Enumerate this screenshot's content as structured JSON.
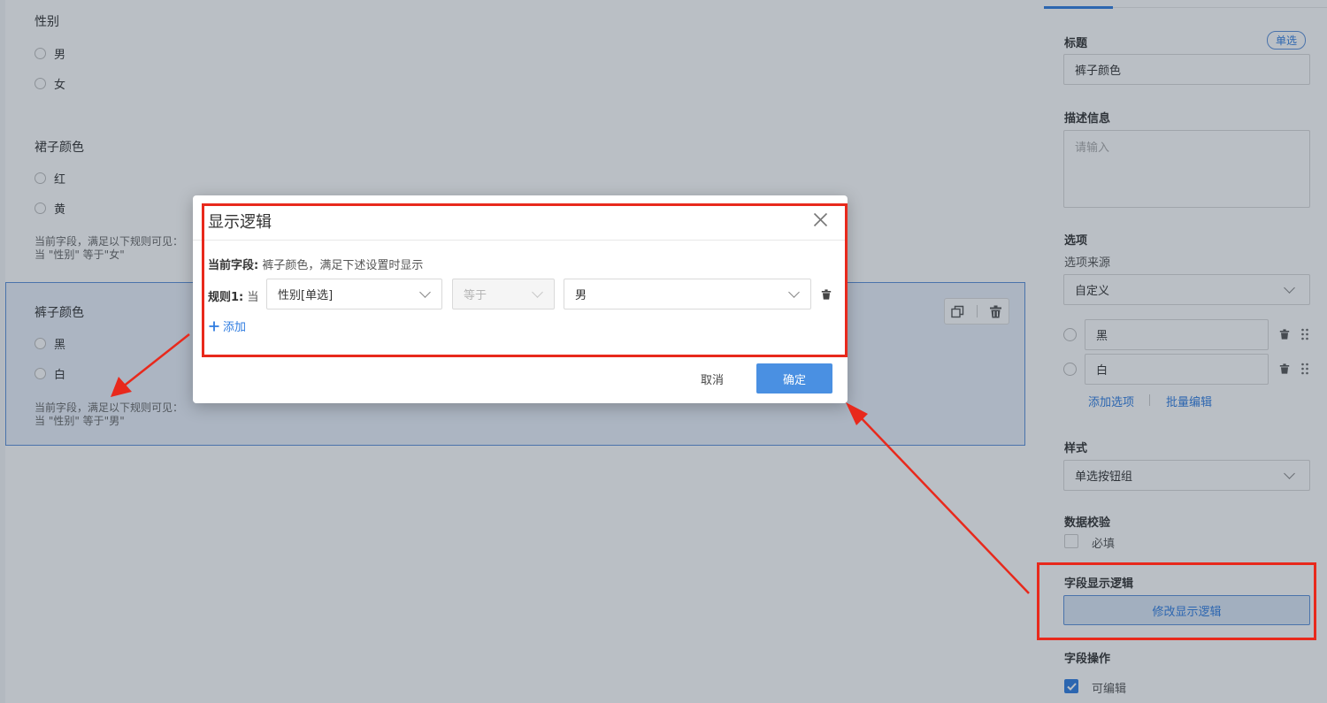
{
  "canvas": {
    "field_gender": {
      "title": "性别",
      "options": [
        "男",
        "女"
      ]
    },
    "field_skirt": {
      "title": "裙子颜色",
      "options": [
        "红",
        "黄"
      ],
      "rule_note_1": "当前字段，满足以下规则可见：",
      "rule_note_2": "当 \"性别\" 等于\"女\""
    },
    "field_pants": {
      "title": "裤子颜色",
      "options": [
        "黑",
        "白"
      ],
      "rule_note_1": "当前字段，满足以下规则可见：",
      "rule_note_2": "当 \"性别\" 等于\"男\""
    }
  },
  "panel": {
    "title_label": "标题",
    "type_tag": "单选",
    "title_value": "裤子颜色",
    "desc_label": "描述信息",
    "desc_placeholder": "请输入",
    "options_label": "选项",
    "options_source_label": "选项来源",
    "options_source_value": "自定义",
    "option_items": [
      "黑",
      "白"
    ],
    "add_option": "添加选项",
    "batch_edit": "批量编辑",
    "style_label": "样式",
    "style_value": "单选按钮组",
    "validation_label": "数据校验",
    "required_label": "必填",
    "logic_label": "字段显示逻辑",
    "logic_button": "修改显示逻辑",
    "ops_label": "字段操作",
    "editable_label": "可编辑"
  },
  "modal": {
    "title": "显示逻辑",
    "current_field_label": "当前字段:",
    "current_field_text": "裤子颜色，满足下述设置时显示",
    "rule_label": "规则1:",
    "rule_when": "当",
    "rule_field": "性别[单选]",
    "rule_operator": "等于",
    "rule_value": "男",
    "add_label": "添加",
    "cancel": "取消",
    "ok": "确定"
  },
  "colors": {
    "accent": "#2f7ce0",
    "primary_button": "#4a90e2",
    "highlight_red": "#e8291c"
  }
}
